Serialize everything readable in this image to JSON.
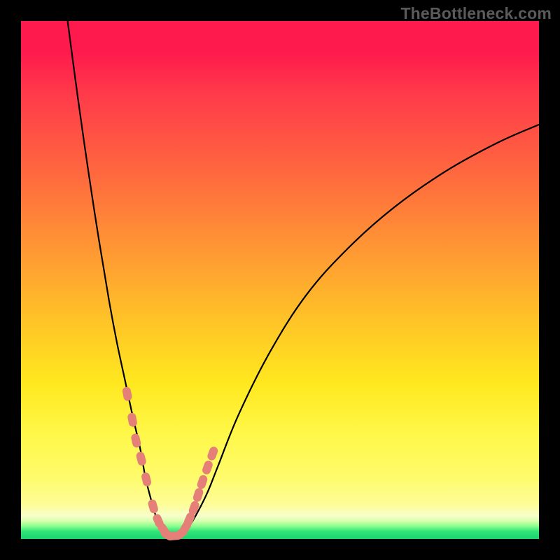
{
  "watermark": "TheBottleneck.com",
  "chart_data": {
    "type": "line",
    "title": "",
    "xlabel": "",
    "ylabel": "",
    "xlim": [
      0,
      100
    ],
    "ylim": [
      0,
      100
    ],
    "grid": false,
    "series": [
      {
        "name": "curve",
        "x": [
          9,
          11,
          13,
          15,
          17,
          18.5,
          20,
          21.5,
          23,
          24,
          25,
          26,
          27,
          29,
          30,
          31,
          32.5,
          34,
          36,
          38,
          42,
          48,
          55,
          63,
          72,
          82,
          92,
          100
        ],
        "y": [
          100,
          85,
          71,
          58,
          46,
          38,
          31,
          24,
          17.5,
          12,
          8,
          4.5,
          2,
          0.5,
          0.5,
          1,
          2.5,
          5,
          9,
          14,
          24,
          36,
          47,
          56,
          64,
          71,
          76.5,
          80
        ]
      }
    ],
    "data_points": {
      "name": "highlighted-points",
      "color": "#e58078",
      "x": [
        20.5,
        21.5,
        22.2,
        23.2,
        24.2,
        25.5,
        26.5,
        27.5,
        28.3,
        29.5,
        30.8,
        31.8,
        32.5,
        33.4,
        34.2,
        35.0,
        36.0,
        37.0
      ],
      "y": [
        28.0,
        23.0,
        19.0,
        15.5,
        11.5,
        6.3,
        3.5,
        1.8,
        0.8,
        0.6,
        1.0,
        2.3,
        3.8,
        6.0,
        8.5,
        11.0,
        13.8,
        16.5
      ]
    },
    "colors": {
      "gradient_top": "#ff1a4d",
      "gradient_mid1": "#ff9a33",
      "gradient_mid2": "#ffe81f",
      "gradient_bottom": "#19d46f",
      "curve": "#000000",
      "points": "#e58078",
      "frame": "#000000"
    }
  }
}
